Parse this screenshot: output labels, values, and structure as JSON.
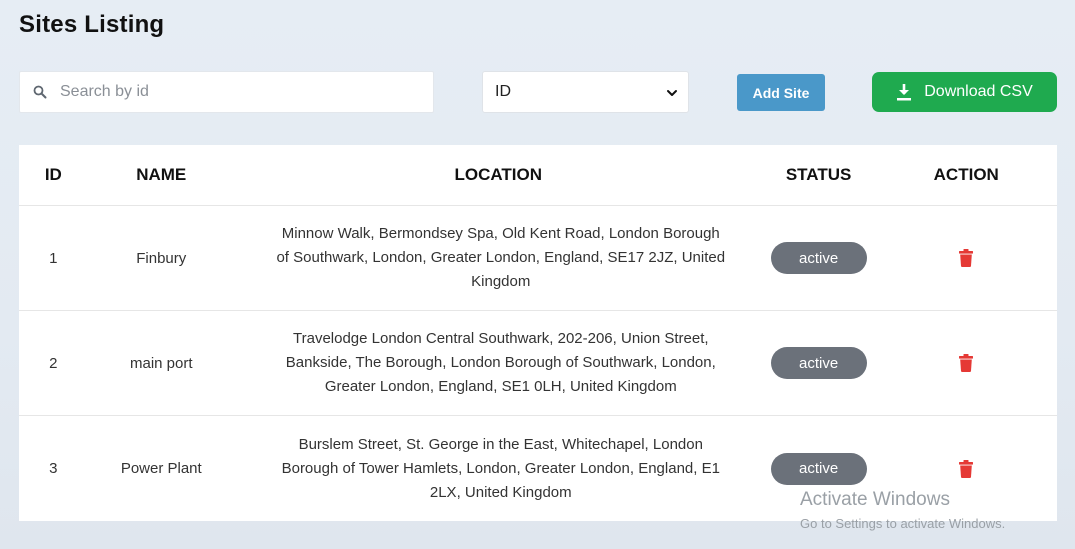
{
  "page": {
    "title": "Sites Listing"
  },
  "search": {
    "placeholder": "Search by id",
    "value": ""
  },
  "filter": {
    "selected": "ID"
  },
  "buttons": {
    "add_site": "Add Site",
    "download_csv": "Download CSV"
  },
  "table": {
    "headers": [
      "ID",
      "NAME",
      "LOCATION",
      "STATUS",
      "ACTION"
    ],
    "rows": [
      {
        "id": "1",
        "name": "Finbury",
        "location_lines": [
          "Minnow Walk, Bermondsey Spa, Old Kent Road, London Borough",
          "of Southwark, London, Greater London, England, SE17 2JZ, United",
          "Kingdom"
        ],
        "status": "active"
      },
      {
        "id": "2",
        "name": "main port",
        "location_lines": [
          "Travelodge London Central Southwark, 202-206, Union Street,",
          "Bankside, The Borough, London Borough of Southwark, London,",
          "Greater London, England, SE1 0LH, United Kingdom"
        ],
        "status": "active"
      },
      {
        "id": "3",
        "name": "Power Plant",
        "location_lines": [
          "Burslem Street, St. George in the East, Whitechapel, London",
          "Borough of Tower Hamlets, London, Greater London, England, E1",
          "2LX, United Kingdom"
        ],
        "status": "active"
      }
    ]
  },
  "watermark": {
    "line1": "Activate Windows",
    "line2": "Go to Settings to activate Windows."
  },
  "colors": {
    "add_button": "#4a98c9",
    "csv_button": "#1faa4f",
    "status_badge": "#6b717a",
    "delete_icon": "#e53935"
  }
}
